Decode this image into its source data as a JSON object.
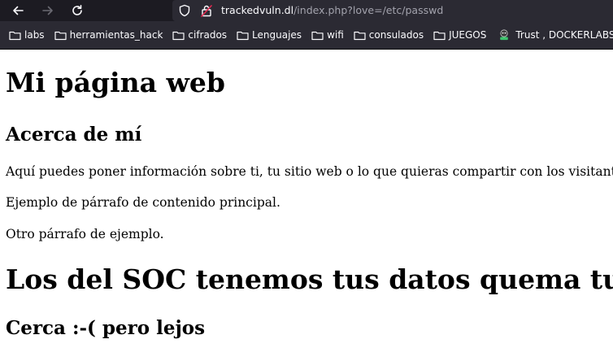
{
  "browser": {
    "url_host": "trackedvuln.dl",
    "url_path": "/index.php?love=/etc/passwd",
    "bookmarks": [
      {
        "label": "labs",
        "icon": "folder-icon"
      },
      {
        "label": "herramientas_hack",
        "icon": "folder-icon"
      },
      {
        "label": "cifrados",
        "icon": "folder-icon"
      },
      {
        "label": "Lenguajes",
        "icon": "folder-icon"
      },
      {
        "label": "wifi",
        "icon": "folder-icon"
      },
      {
        "label": "consulados",
        "icon": "folder-icon"
      },
      {
        "label": "JUEGOS",
        "icon": "folder-icon"
      },
      {
        "label": "Trust , DOCKERLABS",
        "icon": "dockerlabs-favicon"
      }
    ]
  },
  "page": {
    "title": "Mi página web",
    "about_heading": "Acerca de mí",
    "paragraphs": [
      "Aquí puedes poner información sobre ti, tu sitio web o lo que quieras compartir con los visitantes.",
      "Ejemplo de párrafo de contenido principal.",
      "Otro párrafo de ejemplo."
    ],
    "soc_heading": "Los del SOC tenemos tus datos quema tu pc",
    "sub_heading": "Cerca :-( pero lejos"
  },
  "colors": {
    "toolbar_bg": "#1c1b22",
    "urlbar_bg": "#2b2a33",
    "bookmarks_bg": "#2b2a33",
    "chrome_text": "#fbfbfe",
    "url_path_text": "#a3a3ad",
    "page_bg": "#ffffff",
    "page_text": "#000000"
  }
}
